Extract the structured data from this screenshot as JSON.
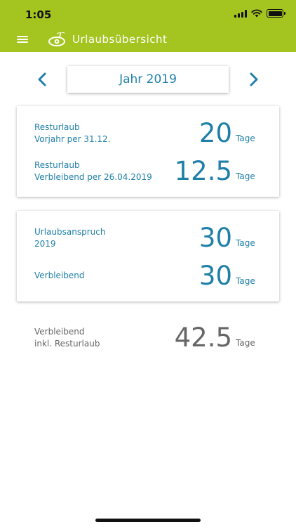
{
  "status_bar": {
    "time": "1:05"
  },
  "app_bar": {
    "title": "Urlaubsübersicht"
  },
  "year_nav": {
    "year_label": "Jahr 2019"
  },
  "colors": {
    "accent_green": "#a4c41f",
    "accent_blue": "#1f7fa8",
    "neutral_gray": "#666666"
  },
  "card_rest": {
    "rows": [
      {
        "label_line1": "Resturlaub",
        "label_line2": "Vorjahr per 31.12.",
        "value": "20",
        "unit": "Tage"
      },
      {
        "label_line1": "Resturlaub",
        "label_line2": "Verbleibend per 26.04.2019",
        "value": "12.5",
        "unit": "Tage"
      }
    ]
  },
  "card_entitlement": {
    "rows": [
      {
        "label_line1": "Urlaubsanspruch",
        "label_line2": "2019",
        "value": "30",
        "unit": "Tage"
      },
      {
        "label_line1": "Verbleibend",
        "label_line2": "",
        "value": "30",
        "unit": "Tage"
      }
    ]
  },
  "total": {
    "label_line1": "Verbleibend",
    "label_line2": "inkl. Resturlaub",
    "value": "42.5",
    "unit": "Tage"
  }
}
